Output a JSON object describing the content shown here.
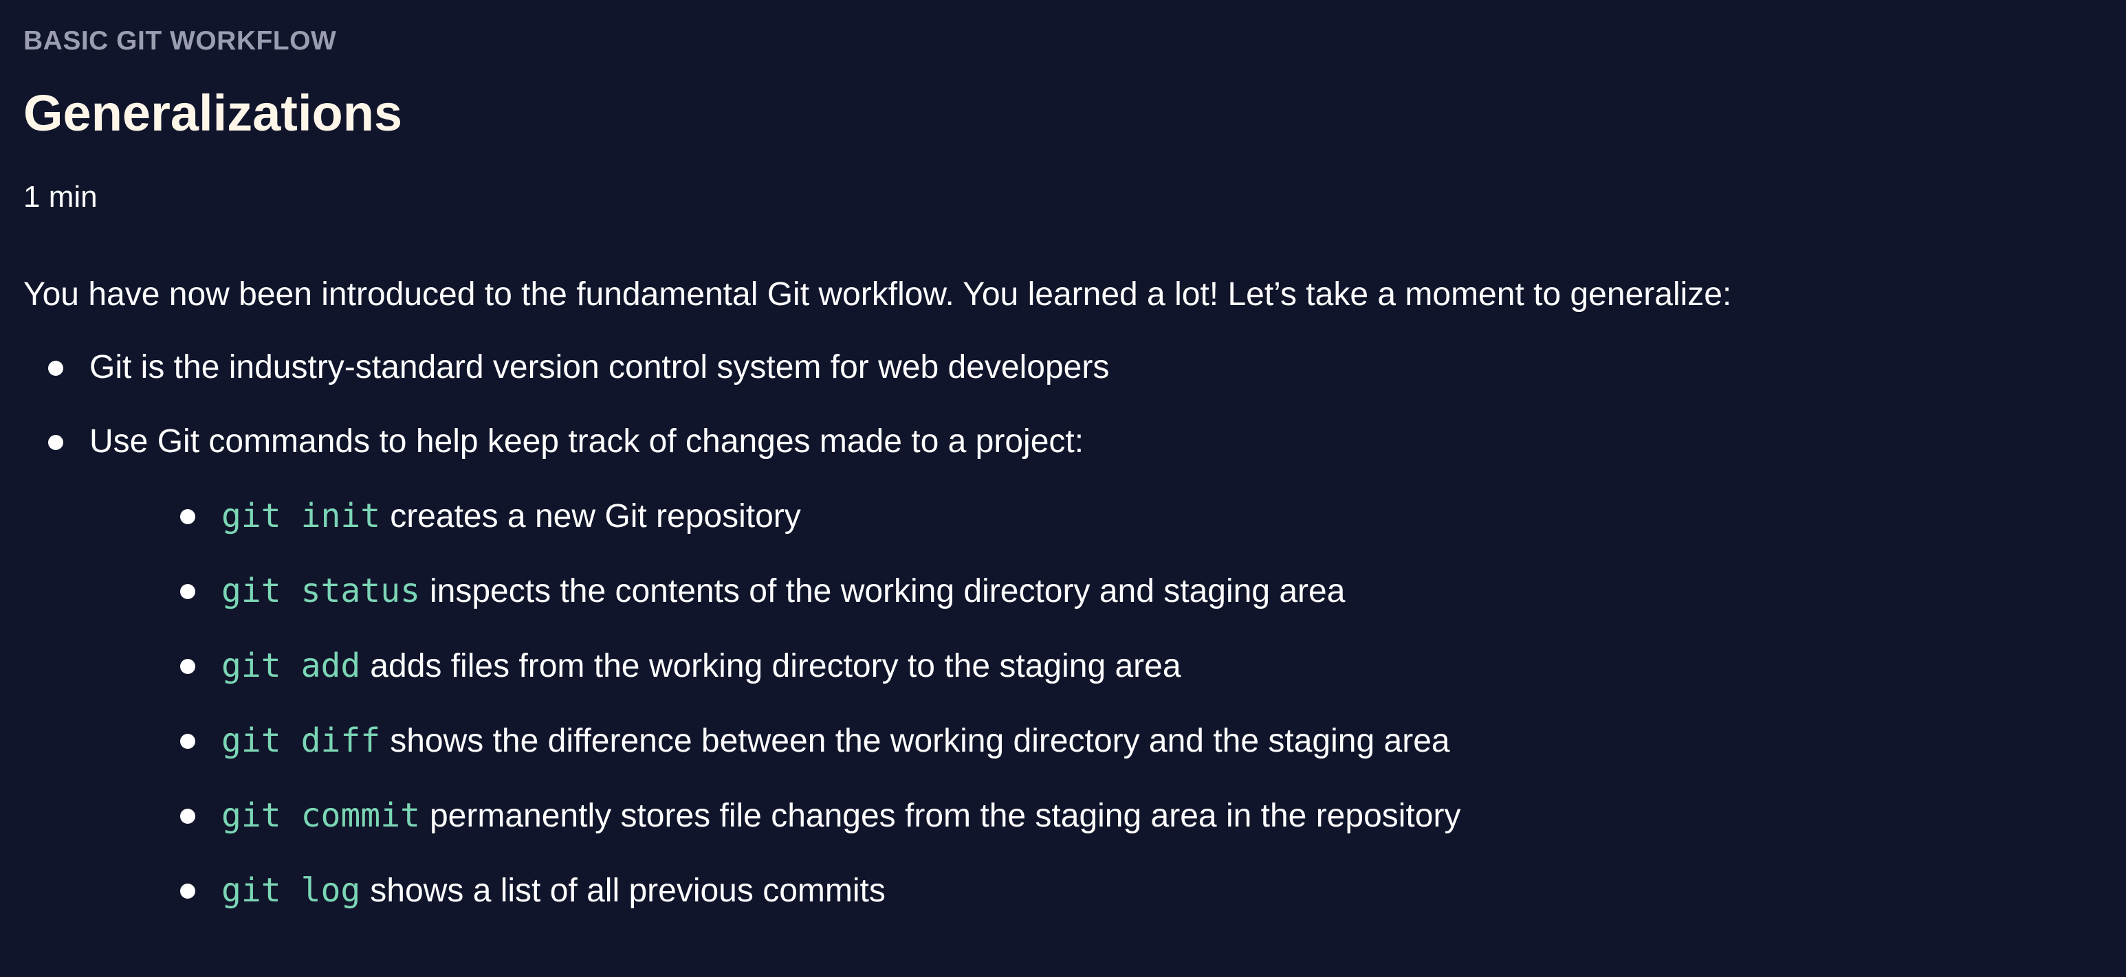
{
  "lesson": {
    "kicker": "BASIC GIT WORKFLOW",
    "title": "Generalizations",
    "duration": "1 min",
    "intro": "You have now been introduced to the fundamental Git workflow. You learned a lot! Let’s take a moment to generalize:",
    "bullets": [
      "Git is the industry-standard version control system for web developers",
      "Use Git commands to help keep track of changes made to a project:"
    ],
    "commands": [
      {
        "cmd": "git init",
        "desc": "creates a new Git repository"
      },
      {
        "cmd": "git status",
        "desc": "inspects the contents of the working directory and staging area"
      },
      {
        "cmd": "git add",
        "desc": "adds files from the working directory to the staging area"
      },
      {
        "cmd": "git diff",
        "desc": "shows the difference between the working directory and the staging area"
      },
      {
        "cmd": "git commit",
        "desc": "permanently stores file changes from the staging area in the repository"
      },
      {
        "cmd": "git log",
        "desc": "shows a list of all previous commits"
      }
    ]
  },
  "colors": {
    "background": "#11152b",
    "title": "#fff6ea",
    "kicker": "#9a9eb0",
    "command": "#7bd6b5",
    "text": "#ffffff"
  }
}
